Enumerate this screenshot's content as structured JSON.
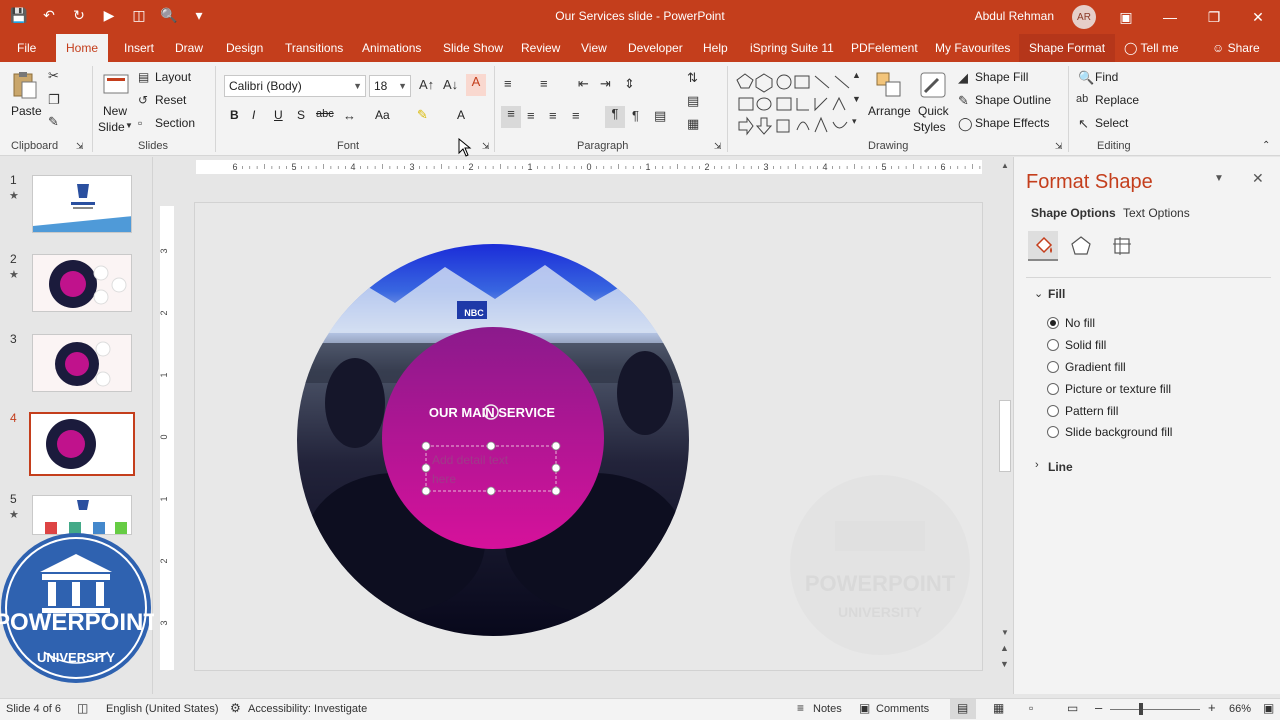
{
  "window": {
    "title": "Our Services slide  -  PowerPoint",
    "user_name": "Abdul Rehman",
    "user_initials": "AR"
  },
  "tabs": [
    "File",
    "Home",
    "Insert",
    "Draw",
    "Design",
    "Transitions",
    "Animations",
    "Slide Show",
    "Review",
    "View",
    "Developer",
    "Help",
    "iSpring Suite 11",
    "PDFelement",
    "My Favourites",
    "Shape Format",
    "Tell me",
    "Share"
  ],
  "ribbon": {
    "clipboard": {
      "label": "Clipboard",
      "paste": "Paste"
    },
    "slides": {
      "label": "Slides",
      "new_slide_1": "New",
      "new_slide_2": "Slide",
      "layout": "Layout",
      "reset": "Reset",
      "section": "Section"
    },
    "font": {
      "label": "Font",
      "family": "Calibri (Body)",
      "size": "18",
      "bold": "B",
      "italic": "I",
      "underline": "U",
      "shadow": "S",
      "strike": "abc",
      "case": "Aa",
      "color": "A"
    },
    "paragraph": {
      "label": "Paragraph"
    },
    "drawing": {
      "label": "Drawing",
      "arrange": "Arrange",
      "quick_styles_1": "Quick",
      "quick_styles_2": "Styles",
      "shape_fill": "Shape Fill",
      "shape_outline": "Shape Outline",
      "shape_effects": "Shape Effects"
    },
    "editing": {
      "label": "Editing",
      "find": "Find",
      "replace": "Replace",
      "select": "Select"
    }
  },
  "thumbnails": [
    {
      "num": "1",
      "star": "★"
    },
    {
      "num": "2",
      "star": "★"
    },
    {
      "num": "3",
      "star": ""
    },
    {
      "num": "4",
      "star": ""
    },
    {
      "num": "5",
      "star": "★"
    }
  ],
  "ruler": {
    "h_ticks": [
      "6",
      "5",
      "4",
      "3",
      "2",
      "1",
      "0",
      "1",
      "2",
      "3",
      "4",
      "5",
      "6"
    ],
    "v_ticks": [
      "3",
      "2",
      "1",
      "0",
      "1",
      "2",
      "3"
    ]
  },
  "slide": {
    "heading": "OUR MAIN SERVICE",
    "detail_line1": "Add detail text",
    "detail_line2": "here",
    "logo_badge": "NBC"
  },
  "watermark": {
    "line1": "POWERPOINT",
    "line2": "UNIVERSITY"
  },
  "format_pane": {
    "title": "Format Shape",
    "tab_shape": "Shape Options",
    "tab_text": "Text Options",
    "section_fill": "Fill",
    "section_line": "Line",
    "fill_options": [
      "No fill",
      "Solid fill",
      "Gradient fill",
      "Picture or texture fill",
      "Pattern fill",
      "Slide background fill"
    ],
    "selected_fill": "No fill"
  },
  "status": {
    "slide_info": "Slide 4 of 6",
    "language": "English (United States)",
    "accessibility": "Accessibility: Investigate",
    "notes": "Notes",
    "comments": "Comments",
    "zoom": "66%"
  },
  "colors": {
    "accent": "#c43e1c",
    "magenta_top": "#8b1a8c",
    "magenta_bottom": "#d6119b"
  }
}
